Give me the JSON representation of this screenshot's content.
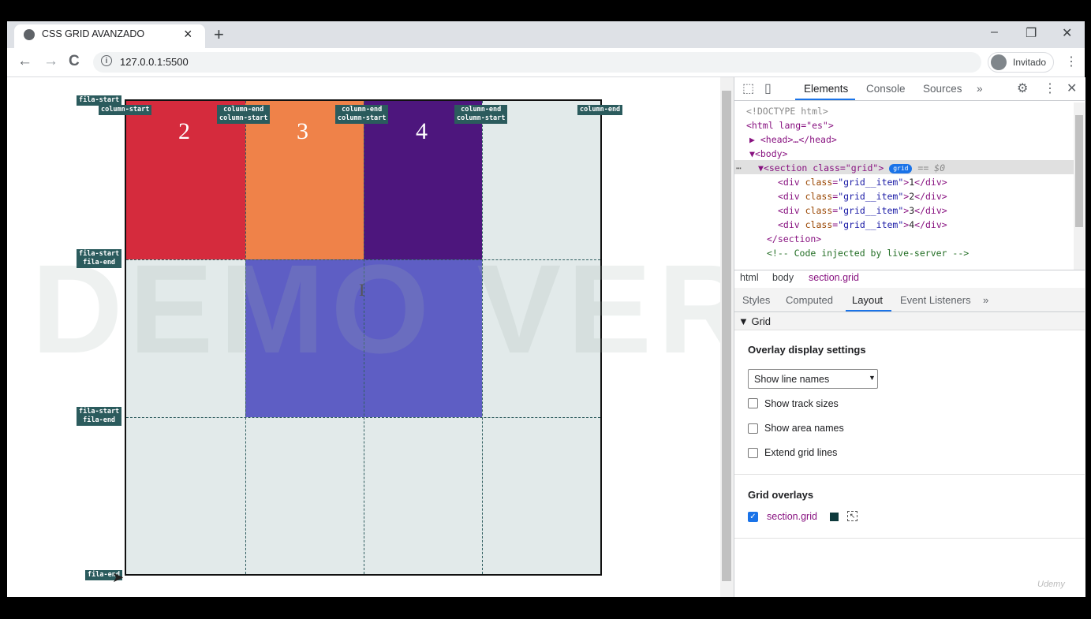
{
  "browser": {
    "tab_title": "CSS GRID AVANZADO",
    "tab_close": "×",
    "new_tab": "+",
    "url": "127.0.0.1:5500",
    "profile_label": "Invitado",
    "back": "←",
    "forward": "→",
    "reload": "C",
    "menu": "⋮",
    "minimize": "–",
    "restore": "❐",
    "close": "✕"
  },
  "page": {
    "watermark": "DEMO VERSION",
    "items": [
      {
        "label": "2",
        "color": "#d52b3d"
      },
      {
        "label": "3",
        "color": "#ef8249"
      },
      {
        "label": "4",
        "color": "#4d167d"
      },
      {
        "label": "1",
        "color": "#5e5ec4"
      }
    ],
    "line_labels": {
      "top_row": "fila-start",
      "col_start": "column-start",
      "col_end_start": [
        "column-end",
        "column-start"
      ],
      "col_end": "column-end",
      "row_mid": [
        "fila-start",
        "fila-end"
      ],
      "bottom_row": "fila-end"
    }
  },
  "devtools": {
    "tabs": [
      "Elements",
      "Console",
      "Sources",
      "»"
    ],
    "dom": {
      "doctype": "<!DOCTYPE html>",
      "html_open": "<html lang=\"es\">",
      "head": "<head>…</head>",
      "body_open": "<body>",
      "section_open": "<section class=\"grid\">",
      "badge": "grid",
      "eq": "== $0",
      "items": [
        "1",
        "2",
        "3",
        "4"
      ],
      "section_close": "</section>",
      "comment": "<!-- Code injected by live-server -->"
    },
    "breadcrumbs": [
      "html",
      "body",
      "section.grid"
    ],
    "sub_tabs": [
      "Styles",
      "Computed",
      "Layout",
      "Event Listeners",
      "»"
    ],
    "grid_section": "▼ Grid",
    "overlay_title": "Overlay display settings",
    "select_value": "Show line names",
    "checkboxes": [
      {
        "label": "Show track sizes",
        "checked": false
      },
      {
        "label": "Show area names",
        "checked": false
      },
      {
        "label": "Extend grid lines",
        "checked": false
      }
    ],
    "overlays_title": "Grid overlays",
    "overlay_item": {
      "label": "section.grid",
      "checked": true,
      "color": "#0e3a3c"
    }
  },
  "udemy_mark": "Udemy"
}
